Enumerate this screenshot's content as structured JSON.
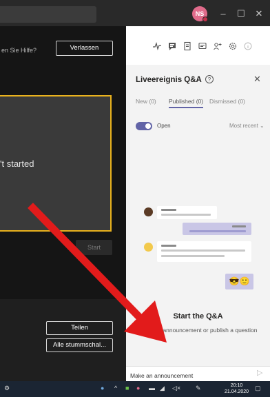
{
  "titlebar": {
    "avatar_initials": "NS",
    "minimize_glyph": "–",
    "maximize_glyph": "☐",
    "close_glyph": "✕"
  },
  "meeting": {
    "help_link": "en Sie Hilfe?",
    "leave_label": "Verlassen",
    "stage_text": "'t started",
    "start_label": "Start",
    "share_label": "Teilen",
    "mute_all_label": "Alle stummschal..."
  },
  "qa_panel": {
    "title": "Liveereignis Q&A",
    "tabs": [
      {
        "label": "New (0)"
      },
      {
        "label": "Published (0)"
      },
      {
        "label": "Dismissed (0)"
      }
    ],
    "toggle_label": "Open",
    "sort_label": "Most recent",
    "empty_title": "Start the Q&A",
    "empty_subtitle": "Make an announcement or publish a question",
    "announcement_placeholder": "Make an announcement"
  },
  "taskbar": {
    "time": "20:10",
    "date": "21.04.2020"
  },
  "colors": {
    "accent": "#6264a7",
    "stage_border": "#e9b21d",
    "arrow": "#e21b1b",
    "avatar": "#e06b8b"
  }
}
